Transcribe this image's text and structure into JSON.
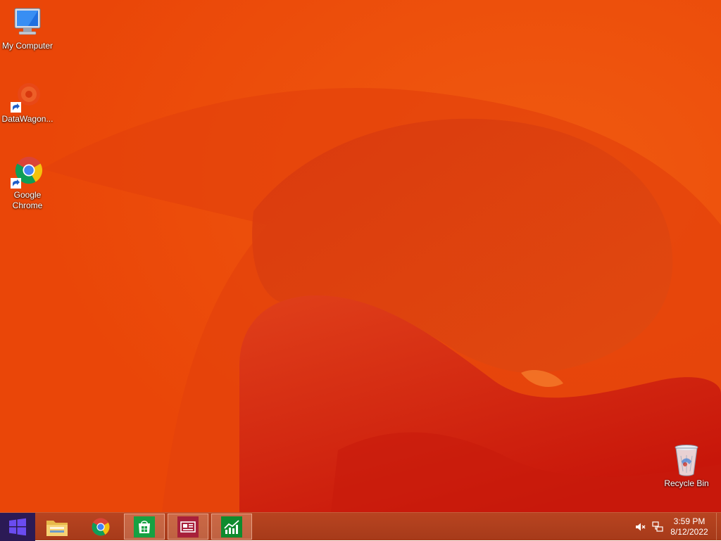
{
  "desktop": {
    "icons": [
      {
        "label": "My Computer",
        "icon": "my-computer-icon"
      },
      {
        "label": "DataWagon...",
        "icon": "datawagon-icon"
      },
      {
        "label": "Google Chrome",
        "icon": "chrome-icon"
      },
      {
        "label": "Recycle Bin",
        "icon": "recycle-bin-icon"
      }
    ]
  },
  "taskbar": {
    "start_icon": "windows-logo-icon",
    "pinned": [
      {
        "icon": "file-explorer-icon"
      },
      {
        "icon": "chrome-icon"
      },
      {
        "icon": "store-icon"
      },
      {
        "icon": "news-icon"
      },
      {
        "icon": "finance-icon"
      }
    ],
    "tray": {
      "volume_icon": "volume-muted-icon",
      "network_icon": "network-icon",
      "time": "3:59 PM",
      "date": "8/12/2022"
    }
  },
  "colors": {
    "wallpaper_base": "#ec4a0a",
    "wallpaper_dark": "#c8200a",
    "taskbar": "#b84420",
    "start_button": "#2b1a55",
    "windows_logo": "#6a4cf0",
    "store_tile": "#16a142",
    "news_tile": "#a8203a",
    "finance_tile": "#0f8b2e"
  }
}
